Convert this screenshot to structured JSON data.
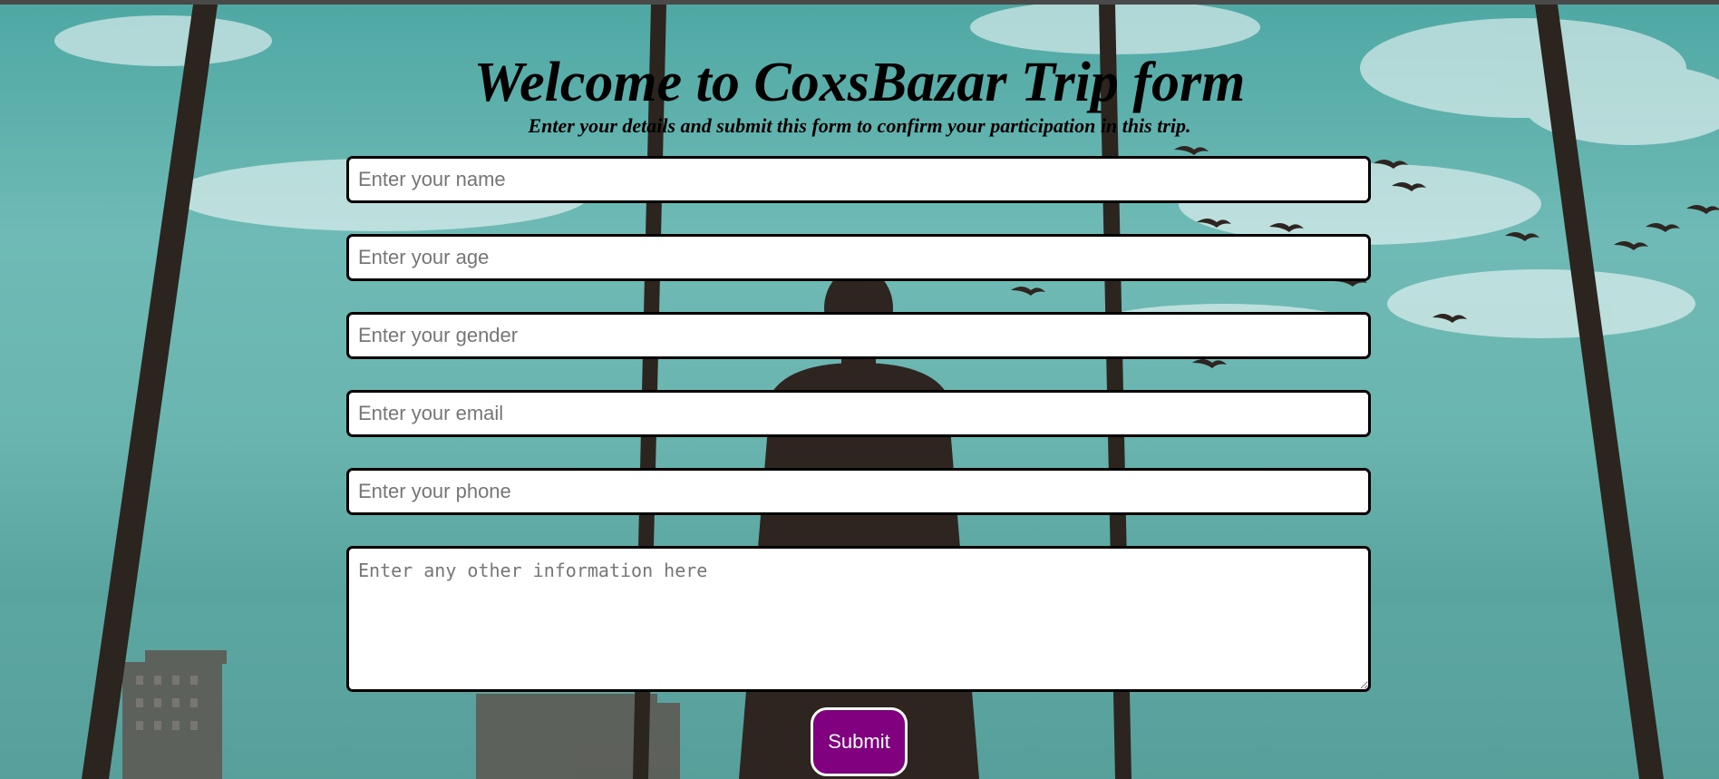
{
  "page": {
    "title": "Welcome to CoxsBazar Trip form",
    "subtitle": "Enter your details and submit this form to confirm your participation in this trip."
  },
  "form": {
    "fields": [
      {
        "name": "name",
        "placeholder": "Enter your name",
        "value": ""
      },
      {
        "name": "age",
        "placeholder": "Enter your age",
        "value": ""
      },
      {
        "name": "gender",
        "placeholder": "Enter your gender",
        "value": ""
      },
      {
        "name": "email",
        "placeholder": "Enter your email",
        "value": ""
      },
      {
        "name": "phone",
        "placeholder": "Enter your phone",
        "value": ""
      }
    ],
    "other_info": {
      "placeholder": "Enter any other information here",
      "value": ""
    },
    "submit_label": "Submit"
  },
  "colors": {
    "submit_bg": "#800080",
    "sky": "#6fbab6"
  }
}
